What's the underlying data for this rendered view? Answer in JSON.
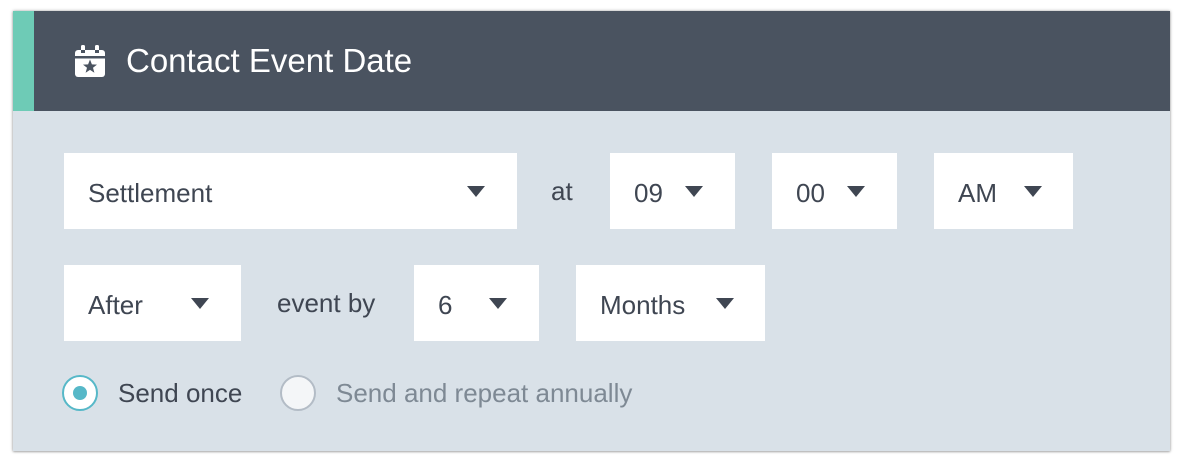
{
  "header": {
    "title": "Contact Event Date",
    "icon": "calendar-star-icon",
    "accent_color": "#6ecbb6",
    "background_color": "#4a5360"
  },
  "row1": {
    "event_select": "Settlement",
    "at_label": "at",
    "hour_select": "09",
    "minute_select": "00",
    "ampm_select": "AM"
  },
  "row2": {
    "direction_select": "After",
    "event_by_label": "event by",
    "amount_select": "6",
    "unit_select": "Months"
  },
  "options": {
    "send_once_label": "Send once",
    "send_once_checked": true,
    "repeat_label": "Send and repeat annually",
    "repeat_checked": false,
    "radio_color": "#56b8c8"
  }
}
